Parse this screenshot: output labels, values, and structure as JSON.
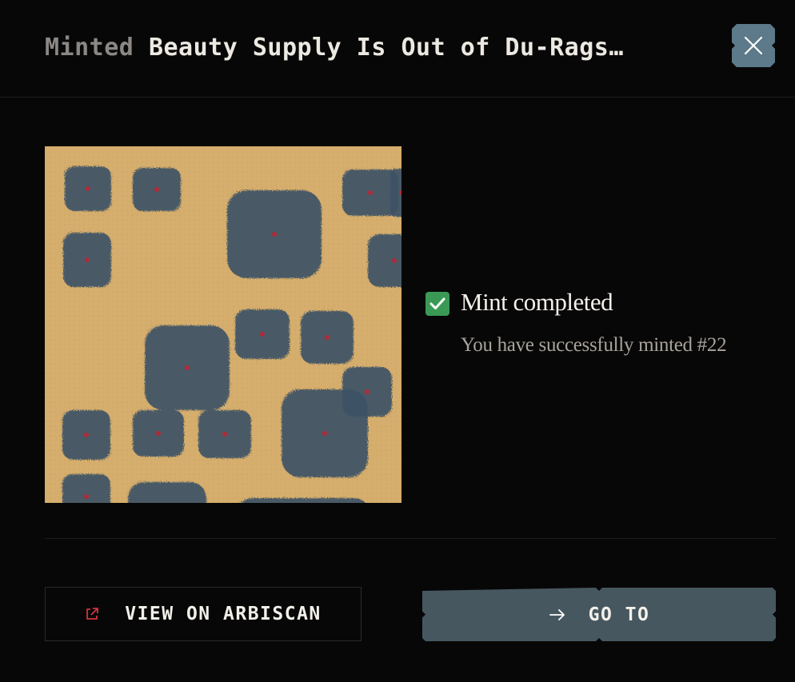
{
  "dialog": {
    "title_prefix": "Minted",
    "title_name": "Beauty Supply Is Out of Du-Rags…",
    "close_icon": "close-icon"
  },
  "artwork": {
    "colors": {
      "background": "#d5ad6c",
      "tuft": "#3d5166",
      "center": "#b02a3a"
    }
  },
  "status": {
    "icon": "check-icon",
    "title": "Mint completed",
    "message": "You have successfully minted #22",
    "color": "#3a9a55"
  },
  "actions": {
    "view": {
      "label": "VIEW ON ARBISCAN",
      "icon": "external-link-icon",
      "icon_color": "#d3333f"
    },
    "go": {
      "label": "GO TO",
      "icon": "arrow-right-icon",
      "bg": "#465760"
    }
  }
}
